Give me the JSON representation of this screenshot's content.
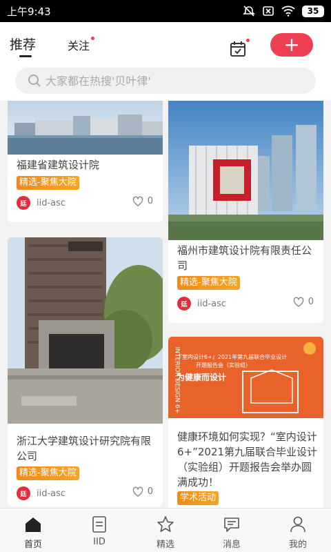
{
  "status_bar": {
    "time": "上午9:43",
    "battery": "35"
  },
  "header": {
    "tabs": [
      {
        "label": "推荐"
      },
      {
        "label": "关注"
      }
    ],
    "search_placeholder": "大家都在热搜'贝叶律'"
  },
  "feed": {
    "left": [
      {
        "title": "福建省建筑设计院",
        "tag": "精选-聚焦大院",
        "author": "iid-asc",
        "avatar_text": "廷",
        "likes": "0"
      },
      {
        "title": "浙江大学建筑设计研究院有限公司",
        "tag": "精选-聚焦大院",
        "author": "iid-asc",
        "avatar_text": "廷",
        "likes": "0"
      }
    ],
    "right": [
      {
        "title": "福州市建筑设计院有限责任公司",
        "tag": "精选-聚焦大院",
        "author": "iid-asc",
        "avatar_text": "廷",
        "likes": "0"
      },
      {
        "title": "健康环境如何实现？“室内设计 6+”2021第九届联合毕业设计（实验组）开题报告会举办圆满成功！",
        "tag": "学术活动",
        "poster_line1": "『室内设计6+』2021年第九届联合毕业设计",
        "poster_line2": "开题报告会（实验组）",
        "poster_headline": "为健康而设计",
        "poster_side": "INTERIOR DESIGN 6+"
      }
    ]
  },
  "tab_bar": {
    "items": [
      {
        "label": "首页",
        "icon": "home-icon"
      },
      {
        "label": "IID",
        "icon": "document-icon"
      },
      {
        "label": "精选",
        "icon": "star-icon"
      },
      {
        "label": "消息",
        "icon": "message-icon"
      },
      {
        "label": "我的",
        "icon": "user-icon"
      }
    ]
  },
  "colors": {
    "accent": "#ee3f55",
    "tag": "#f5a623"
  }
}
